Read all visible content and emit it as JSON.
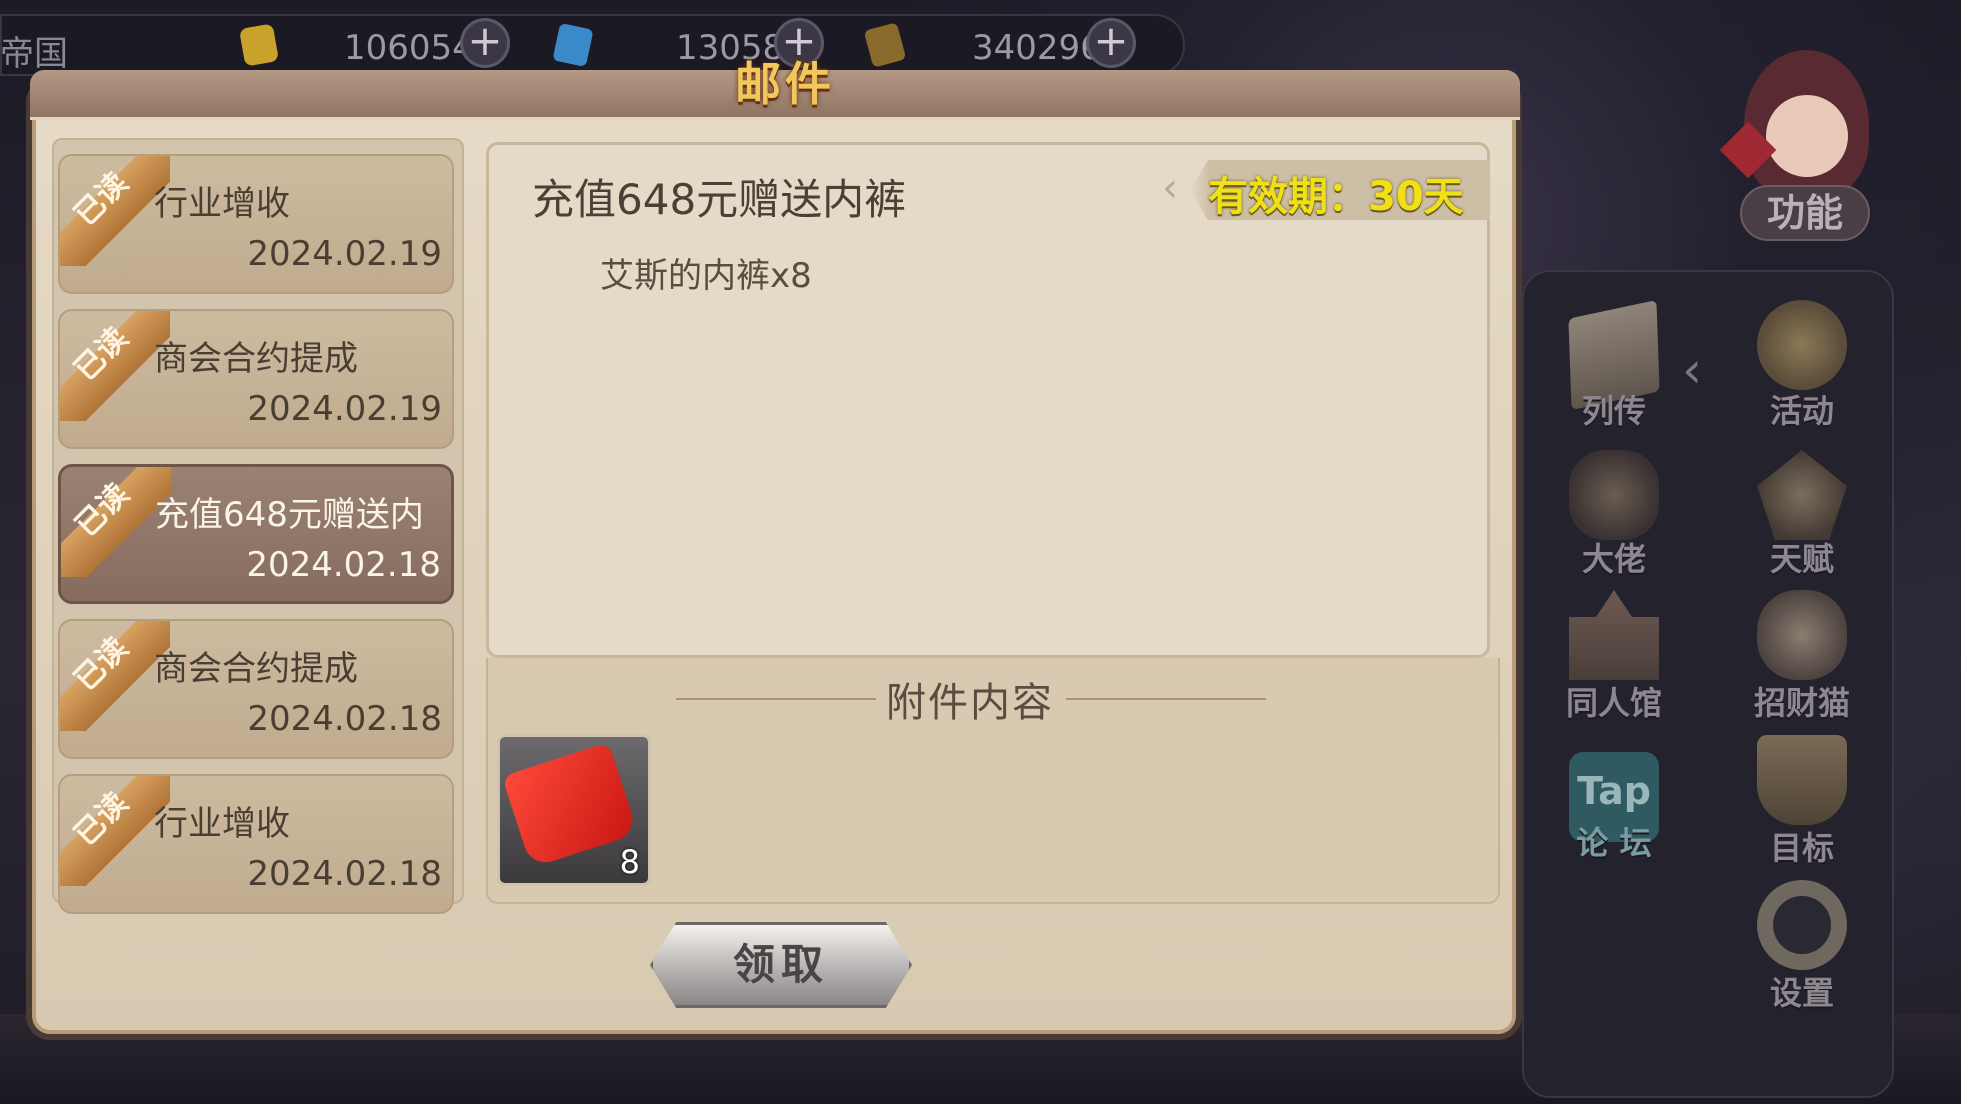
{
  "topbar": {
    "region_label": "帝国",
    "gold": "106054",
    "gems": "13058",
    "resource3": "340296"
  },
  "right_menu": {
    "function_label": "功能",
    "items": [
      {
        "label": "列传",
        "icon": "book-icon"
      },
      {
        "label": "活动",
        "icon": "star-emblem-icon"
      },
      {
        "label": "大佬",
        "icon": "bigshot-icon"
      },
      {
        "label": "天赋",
        "icon": "talent-icon"
      },
      {
        "label": "同人馆",
        "icon": "castle-icon"
      },
      {
        "label": "招财猫",
        "icon": "lucky-cat-icon"
      },
      {
        "label": "Tap\n论坛",
        "icon": "tap-forum-icon"
      },
      {
        "label": "目标",
        "icon": "target-icon"
      },
      {
        "label": "设置",
        "icon": "gear-icon"
      }
    ]
  },
  "dialog": {
    "title": "邮件",
    "mails": [
      {
        "badge": "已读",
        "title": "行业增收",
        "date": "2024.02.19",
        "selected": false
      },
      {
        "badge": "已读",
        "title": "商会合约提成",
        "date": "2024.02.19",
        "selected": false
      },
      {
        "badge": "已读",
        "title": "充值648元赠送内",
        "date": "2024.02.18",
        "selected": true
      },
      {
        "badge": "已读",
        "title": "商会合约提成",
        "date": "2024.02.18",
        "selected": false
      },
      {
        "badge": "已读",
        "title": "行业增收",
        "date": "2024.02.18",
        "selected": false
      }
    ],
    "detail": {
      "title": "充值648元赠送内裤",
      "validity": "有效期：30天",
      "body": "艾斯的内裤x8",
      "attachments_title": "附件内容",
      "attachment": {
        "icon": "red-underwear-icon",
        "count": "8"
      }
    },
    "claim_button": "领取"
  }
}
